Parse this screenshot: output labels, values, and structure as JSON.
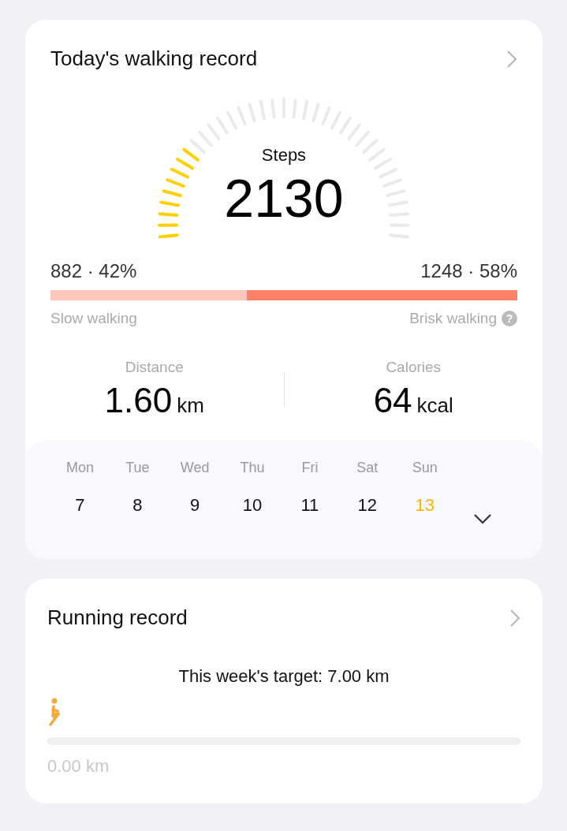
{
  "walking": {
    "title": "Today's walking record",
    "gauge": {
      "label": "Steps",
      "value": "2130",
      "level": 0.25
    },
    "split": {
      "slow_reading": "882 · 42%",
      "brisk_reading": "1248 · 58%",
      "level": 0.42,
      "slow_label": "Slow walking",
      "brisk_label": "Brisk walking",
      "help": "?"
    },
    "stats": [
      {
        "label": "Distance",
        "value": "1.60",
        "unit": "km"
      },
      {
        "label": "Calories",
        "value": "64",
        "unit": "kcal"
      }
    ],
    "week": [
      {
        "day": "Mon",
        "date": "7",
        "selected": false
      },
      {
        "day": "Tue",
        "date": "8",
        "selected": false
      },
      {
        "day": "Wed",
        "date": "9",
        "selected": false
      },
      {
        "day": "Thu",
        "date": "10",
        "selected": false
      },
      {
        "day": "Fri",
        "date": "11",
        "selected": false
      },
      {
        "day": "Sat",
        "date": "12",
        "selected": false
      },
      {
        "day": "Sun",
        "date": "13",
        "selected": true
      }
    ]
  },
  "running": {
    "title": "Running record",
    "target": "This week's target: 7.00 km",
    "distance": "0.00 km"
  }
}
